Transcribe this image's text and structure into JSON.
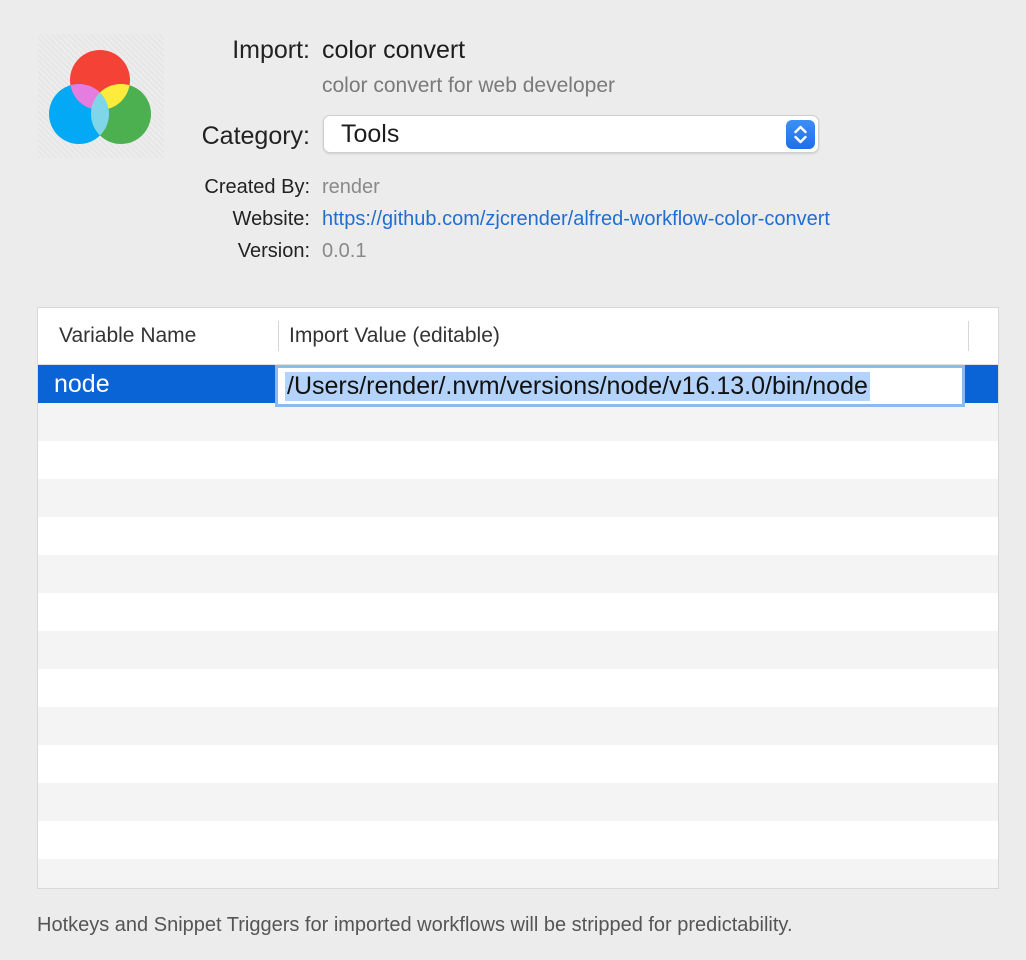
{
  "header": {
    "import_label": "Import:",
    "workflow_name": "color convert",
    "workflow_subtitle": "color convert for web developer",
    "category_label": "Category:",
    "category_value": "Tools",
    "created_by_label": "Created By:",
    "created_by_value": "render",
    "website_label": "Website:",
    "website_value": "https://github.com/zjcrender/alfred-workflow-color-convert",
    "version_label": "Version:",
    "version_value": "0.0.1"
  },
  "icon": {
    "name": "color-convert-icon",
    "colors": [
      "#f44336",
      "#03a9f4",
      "#4caf50",
      "#ffeb3b"
    ]
  },
  "table": {
    "columns": [
      "Variable Name",
      "Import Value (editable)"
    ],
    "rows": [
      {
        "name": "node",
        "value": "/Users/render/.nvm/versions/node/v16.13.0/bin/node",
        "selected": true
      }
    ]
  },
  "footer": {
    "note": "Hotkeys and Snippet Triggers for imported workflows will be stripped for predictability."
  },
  "colors": {
    "selection": "#0a64d6",
    "link": "#1f6fd1",
    "accent": "#1f6fe8"
  }
}
